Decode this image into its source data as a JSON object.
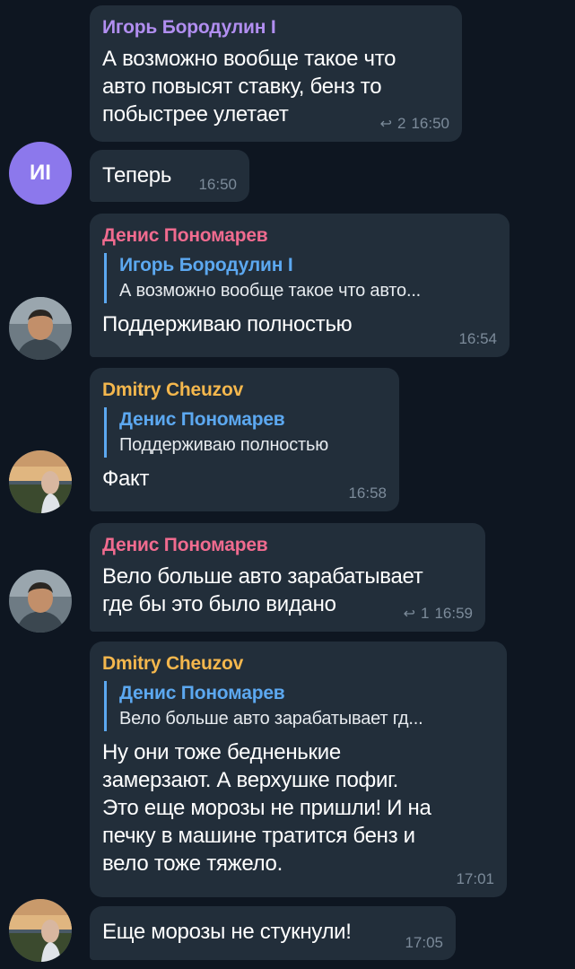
{
  "messages": [
    {
      "sender": "Игорь Бородулин I",
      "text": "А возможно вообще такое что\nавто повысят ставку, бенз то\nпобыстрее улетает",
      "reactions": "2",
      "time": "16:50"
    },
    {
      "avatar_initials": "ИI",
      "text": "Теперь",
      "time": "16:50"
    },
    {
      "sender": "Денис Пономарев",
      "reply_name": "Игорь Бородулин I",
      "reply_text": "А возможно вообще такое что авто...",
      "text": "Поддерживаю полностью",
      "time": "16:54"
    },
    {
      "sender": "Dmitry Cheuzov",
      "reply_name": "Денис Пономарев",
      "reply_text": "Поддерживаю полностью",
      "text": "Факт",
      "time": "16:58"
    },
    {
      "sender": "Денис Пономарев",
      "text": "Вело больше авто зарабатывает\nгде бы это было видано",
      "reactions": "1",
      "time": "16:59"
    },
    {
      "sender": "Dmitry Cheuzov",
      "reply_name": "Денис Пономарев",
      "reply_text": "Вело больше авто зарабатывает гд...",
      "text": "Ну они тоже бедненькие\nзамерзают. А верхушке пофиг.\nЭто еще морозы не пришли! И на\nпечку в машине тратится бенз и\nвело тоже тяжело.",
      "time": "17:01"
    },
    {
      "text": "Еще морозы не стукнули!",
      "time": "17:05"
    }
  ],
  "colors": {
    "background": "#0e1621",
    "bubble": "#222e3a",
    "sender_igor": "#b18ef0",
    "sender_denis": "#f06b8f",
    "sender_dmitry": "#f4b74d",
    "reply_accent": "#5ca8f0",
    "avatar_igor": "#8c78ec"
  },
  "icons": {
    "reply_count": "reply-arrow-icon"
  }
}
